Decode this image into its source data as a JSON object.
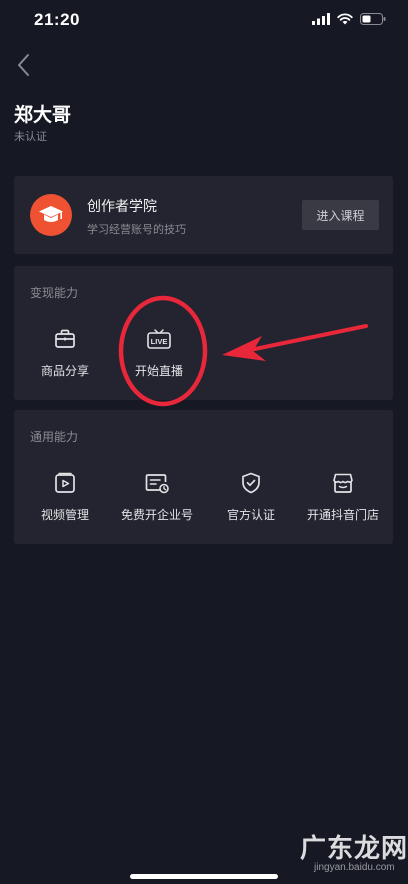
{
  "status_bar": {
    "time": "21:20"
  },
  "profile": {
    "name": "郑大哥",
    "verification": "未认证"
  },
  "academy": {
    "title": "创作者学院",
    "description": "学习经营账号的技巧",
    "enter_button": "进入课程"
  },
  "monetization": {
    "section_title": "变现能力",
    "tools": [
      {
        "label": "商品分享",
        "icon": "shopping-bag-icon"
      },
      {
        "label": "开始直播",
        "icon": "live-tv-icon"
      }
    ]
  },
  "general": {
    "section_title": "通用能力",
    "tools": [
      {
        "label": "视频管理",
        "icon": "video-play-icon"
      },
      {
        "label": "免费开企业号",
        "icon": "enterprise-card-icon"
      },
      {
        "label": "官方认证",
        "icon": "shield-check-icon"
      },
      {
        "label": "开通抖音门店",
        "icon": "storefront-icon"
      }
    ]
  },
  "annotation": {
    "color": "#e8283a",
    "highlighted_tool": "开始直播"
  },
  "watermark": {
    "text": "广东龙网",
    "url": "jingyan.baidu.com"
  },
  "colors": {
    "background": "#161823",
    "card": "#23242f",
    "academy_logo": "#ee5233",
    "annotation_red": "#e8283a"
  }
}
